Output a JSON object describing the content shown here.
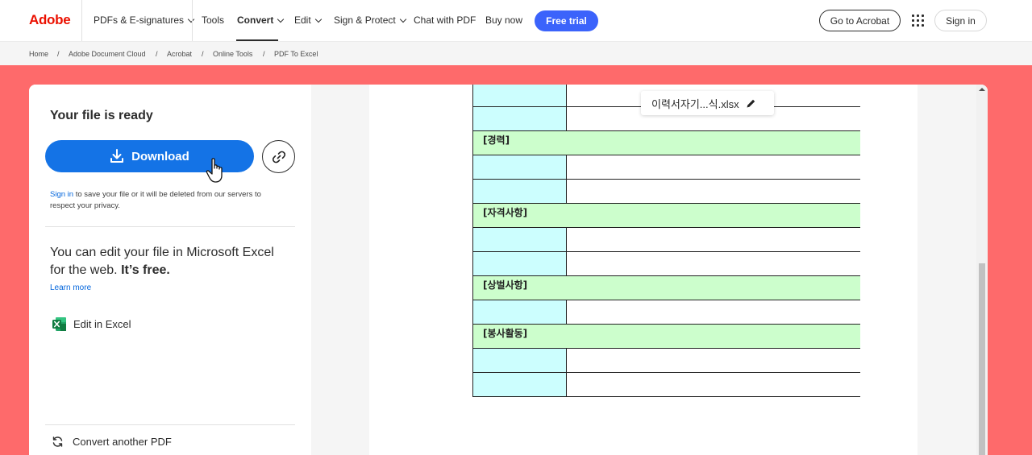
{
  "nav": {
    "brand": "Adobe",
    "items": [
      {
        "label": "PDFs & E-signatures",
        "dropdown": true
      },
      {
        "label": "Tools",
        "dropdown": false
      },
      {
        "label": "Convert",
        "dropdown": true,
        "active": true
      },
      {
        "label": "Edit",
        "dropdown": true
      },
      {
        "label": "Sign & Protect",
        "dropdown": true
      },
      {
        "label": "Chat with PDF",
        "dropdown": false
      },
      {
        "label": "Buy now",
        "dropdown": false
      }
    ],
    "free_trial": "Free trial",
    "go_to_acrobat": "Go to Acrobat",
    "sign_in": "Sign in"
  },
  "breadcrumb": [
    "Home",
    "Adobe Document Cloud",
    "Acrobat",
    "Online Tools",
    "PDF To Excel"
  ],
  "left": {
    "title": "Your file is ready",
    "download": "Download",
    "sign_in_link": "Sign in",
    "sign_note": " to save your file or it will be deleted from our servers to respect your privacy.",
    "excel_msg": "You can edit your file in Microsoft Excel for the web.",
    "excel_free": "It’s free.",
    "learn_more": "Learn more",
    "edit_in_excel": "Edit in Excel",
    "convert_another": "Convert another PDF"
  },
  "preview": {
    "filename": "이력서자기...식.xlsx",
    "sections": [
      "[경력]",
      "[자격사항]",
      "[상벌사항]",
      "[봉사활동]"
    ]
  },
  "colors": {
    "brand_red": "#eb1000",
    "hero_bg": "#fe6a6b",
    "primary_blue": "#1473e6",
    "trial_blue": "#3b63fb",
    "cyan_cell": "#ccfefe",
    "green_section": "#ccfecc"
  },
  "icons": [
    "apps-grid-icon",
    "download-icon",
    "link-icon",
    "hand-cursor-icon",
    "excel-icon",
    "refresh-icon",
    "pencil-icon"
  ]
}
